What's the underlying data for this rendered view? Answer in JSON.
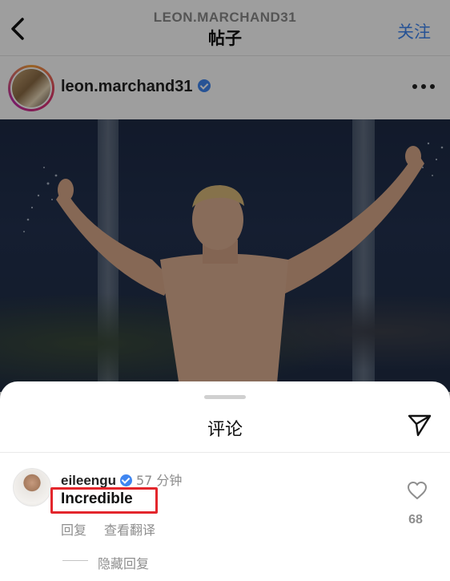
{
  "header": {
    "username": "LEON.MARCHAND31",
    "title": "帖子",
    "follow_label": "关注"
  },
  "post": {
    "author": "leon.marchand31",
    "verified": true
  },
  "comments_sheet": {
    "title": "评论",
    "comment": {
      "user": "eileengu",
      "verified": true,
      "time": "57 分钟",
      "text": "Incredible",
      "reply_label": "回复",
      "translate_label": "查看翻译",
      "like_count": "68"
    },
    "hide_replies_label": "隐藏回复"
  },
  "icons": {
    "back": "chevron-left-icon",
    "more": "more-horizontal-icon",
    "share": "send-icon",
    "like": "heart-icon",
    "verified": "verified-badge-icon"
  },
  "colors": {
    "accent": "#3f86f1",
    "highlight_box": "#e3262c",
    "muted_text": "#8e8e8e"
  }
}
